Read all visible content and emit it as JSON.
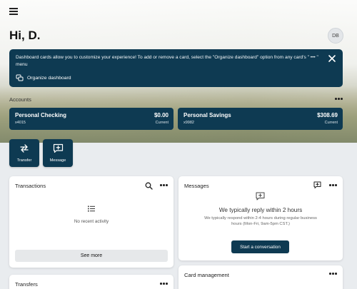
{
  "header": {
    "menu_icon": "hamburger-menu-icon",
    "greeting": "Hi, D.",
    "avatar_initials": "DB"
  },
  "banner": {
    "text": "Dashboard cards allow you to customize your experience! To add or remove a card, select the \"Organize dashboard\" option from any card's \" ••• \" menu",
    "organize_label": "Organize dashboard",
    "close_icon": "close-icon",
    "background": "#0e3a52"
  },
  "accounts": {
    "label": "Accounts",
    "items": [
      {
        "name": "Personal Checking",
        "number": "x4015",
        "balance": "$0.00",
        "balance_label": "Current"
      },
      {
        "name": "Personal Savings",
        "number": "x9982",
        "balance": "$308.69",
        "balance_label": "Current"
      }
    ]
  },
  "actions": [
    {
      "label": "Transfer",
      "icon": "transfer-arrows-icon"
    },
    {
      "label": "Message",
      "icon": "message-plus-icon"
    }
  ],
  "transactions": {
    "title": "Transactions",
    "empty_text": "No recent activity",
    "see_more_label": "See more"
  },
  "messages": {
    "title": "Messages",
    "heading": "We typically reply within 2 hours",
    "subtext": "We typically respond within 2-4 hours during regular business hours (Mon-Fri, 9am-5pm CST.)",
    "button_label": "Start a conversation"
  },
  "transfers": {
    "title": "Transfers"
  },
  "card_management": {
    "title": "Card management"
  },
  "colors": {
    "primary": "#0e3a52",
    "page_background": "#e9ecef",
    "card_background": "#ffffff"
  }
}
